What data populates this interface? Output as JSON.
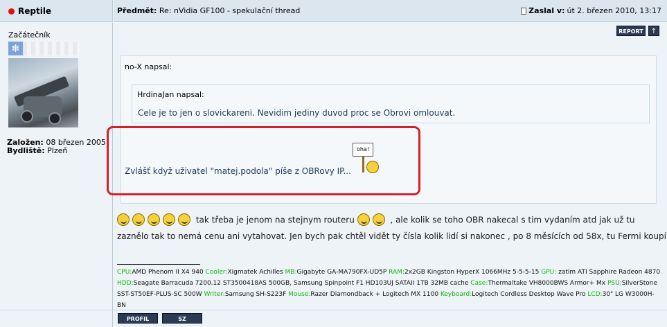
{
  "post": {
    "author": "Reptile",
    "subject_label": "Předmět:",
    "subject": "Re: nVidia GF100 - spekulační thread",
    "posted_label": "Zaslal v:",
    "posted_date": "út 2. březen 2010, 13:17"
  },
  "profile": {
    "rank": "Začátečník",
    "joined_label": "Založen:",
    "joined": "08 březen 2005",
    "location_label": "Bydliště:",
    "location": "Plzeň"
  },
  "buttons": {
    "report": "REPORT",
    "top": "↑",
    "profile": "PROFIL",
    "pm": "SZ"
  },
  "quote_outer": {
    "author": "no-X napsal:",
    "text": "Zvlášť když uživatel \"matej.podola\" píše z OBRovy IP..."
  },
  "quote_inner": {
    "author": "HrdinaJan napsal:",
    "text": "Cele je to jen o slovickareni. Nevidim jediny duvod proc se Obrovi omlouvat."
  },
  "sign_smiley_text": "oha!",
  "message": {
    "line1_a": "tak třeba je jenom na stejnym routeru",
    "line1_b": ", ale kolik se toho OBR nakecal s tim vydaním atd jak už tu",
    "line2": "zaznělo tak to nemá cenu ani vytahovat. Jen bych pak chtěl vidět ty čísla kolik lidí si nakonec , po 8 měsících od 58x, tu Fermi koupí"
  },
  "signature": {
    "cpu_k": "CPU:",
    "cpu": "AMD Phenom II X4 940",
    "cooler_k": "Cooler:",
    "cooler": "Xigmatek Achilles",
    "mb_k": "MB:",
    "mb": "Gigabyte GA-MA790FX-UD5P",
    "ram_k": "RAM:",
    "ram": "2x2GB Kingston HyperX 1066MHz 5-5-5-15",
    "gpu_k": "GPU:",
    "gpu": " zatim ATI Sapphire Radeon 4870",
    "hdd_k": "HDD:",
    "hdd": "Seagate Barracuda 7200.12 ST3500418AS 500GB, Samsung Spinpoint F1 HD103UJ SATAII 1TB 32MB cache",
    "case_k": "Case:",
    "case": "Thermaltake VH8000BWS Armor+ Mx",
    "psu_k": "PSU:",
    "psu": "SilverStone SST-ST50EF-PLUS-SC 500W",
    "writer_k": "Writer:",
    "writer": "Samsung SH-S223F",
    "mouse_k": "Mouse:",
    "mouse": "Razer Diamondback + Logitech MX 1100",
    "keyboard_k": "Keyboard:",
    "keyboard": "Logitech Cordless Desktop Wave Pro",
    "lcd_k": "LCD:",
    "lcd": "30\" LG W3000H-BN"
  },
  "colors": {
    "highlight": "#d51f2a",
    "sig_key": "#12b312",
    "button_bg": "#2b3a55"
  }
}
